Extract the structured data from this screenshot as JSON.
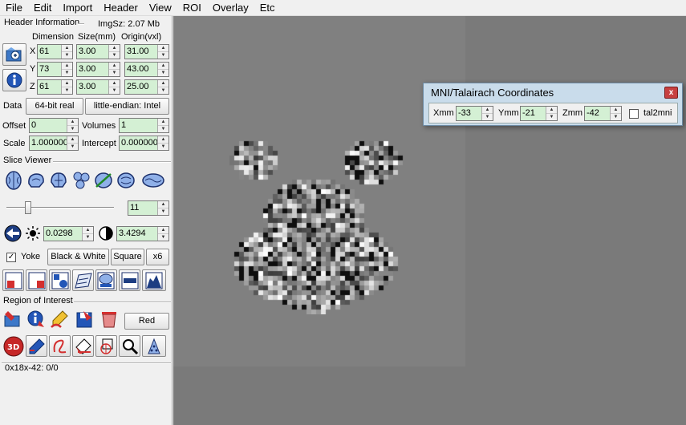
{
  "menu": [
    "File",
    "Edit",
    "Import",
    "Header",
    "View",
    "ROI",
    "Overlay",
    "Etc"
  ],
  "header": {
    "group_label": "Header Information",
    "imgsz": "ImgSz: 2.07 Mb",
    "col_dimension": "Dimension",
    "col_size": "Size(mm)",
    "col_origin": "Origin(vxl)",
    "rows": [
      {
        "axis": "X",
        "dim": "61",
        "size": "3.00",
        "origin": "31.00"
      },
      {
        "axis": "Y",
        "dim": "73",
        "size": "3.00",
        "origin": "43.00"
      },
      {
        "axis": "Z",
        "dim": "61",
        "size": "3.00",
        "origin": "25.00"
      }
    ],
    "data_label": "Data",
    "data_type": "64-bit real",
    "endian": "little-endian: Intel",
    "offset_label": "Offset",
    "offset": "0",
    "volumes_label": "Volumes",
    "volumes": "1",
    "scale_label": "Scale",
    "scale": "1.000000",
    "intercept_label": "Intercept",
    "intercept": "0.000000"
  },
  "slice_viewer": {
    "group_label": "Slice Viewer",
    "slice": "11",
    "slice_level": 0.2,
    "brightness": "0.0298",
    "contrast": "3.4294",
    "yoke_label": "Yoke",
    "yoke_checked": "✓",
    "colormap_button": "Black & White",
    "square_button": "Square",
    "zoom_button": "x6"
  },
  "roi": {
    "group_label": "Region of Interest",
    "color_button": "Red"
  },
  "status": "0x18x-42: 0/0",
  "mni": {
    "title": "MNI/Talairach Coordinates",
    "close": "x",
    "x_label": "Xmm",
    "x": "-33",
    "y_label": "Ymm",
    "y": "-21",
    "z_label": "Zmm",
    "z": "-42",
    "tal_label": "tal2mni"
  }
}
